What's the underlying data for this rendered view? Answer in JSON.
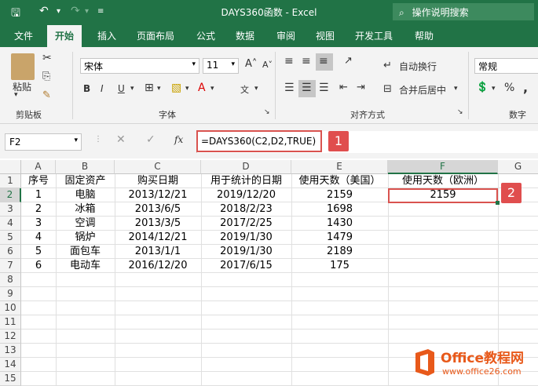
{
  "window": {
    "title": "DAYS360函数  -  Excel",
    "search_placeholder": "操作说明搜索"
  },
  "tabs": [
    "文件",
    "开始",
    "插入",
    "页面布局",
    "公式",
    "数据",
    "审阅",
    "视图",
    "开发工具",
    "帮助"
  ],
  "ribbon": {
    "paste_label": "粘贴",
    "clipboard_label": "剪贴板",
    "font_name": "宋体",
    "font_size": "11",
    "font_label": "字体",
    "wrap_text": "自动换行",
    "merge_center": "合并后居中",
    "align_label": "对齐方式",
    "number_format": "常规",
    "number_label": "数字",
    "bold": "B",
    "italic": "I",
    "underline": "U"
  },
  "formula_bar": {
    "name_box": "F2",
    "formula": "=DAYS360(C2,D2,TRUE)",
    "fx": "fx"
  },
  "badges": {
    "one": "1",
    "two": "2"
  },
  "columns": [
    "A",
    "B",
    "C",
    "D",
    "E",
    "F",
    "G"
  ],
  "rows": [
    "1",
    "2",
    "3",
    "4",
    "5",
    "6",
    "7",
    "8",
    "9",
    "10",
    "11",
    "12",
    "13",
    "14",
    "15"
  ],
  "table": {
    "headers": [
      "序号",
      "固定资产",
      "购买日期",
      "用于统计的日期",
      "使用天数（美国）",
      "使用天数（欧洲）"
    ],
    "data": [
      [
        "1",
        "电脑",
        "2013/12/21",
        "2019/12/20",
        "2159",
        "2159"
      ],
      [
        "2",
        "冰箱",
        "2013/6/5",
        "2018/2/23",
        "1698",
        ""
      ],
      [
        "3",
        "空调",
        "2013/3/5",
        "2017/2/25",
        "1430",
        ""
      ],
      [
        "4",
        "锅炉",
        "2014/12/21",
        "2019/1/30",
        "1479",
        ""
      ],
      [
        "5",
        "面包车",
        "2013/1/1",
        "2019/1/30",
        "2189",
        ""
      ],
      [
        "6",
        "电动车",
        "2016/12/20",
        "2017/6/15",
        "175",
        ""
      ]
    ]
  },
  "watermark": {
    "brand": "Office教程网",
    "url": "www.office26.com"
  },
  "colors": {
    "excel_green": "#217346",
    "highlight_red": "#d9534f",
    "watermark_orange": "#e8591a"
  }
}
